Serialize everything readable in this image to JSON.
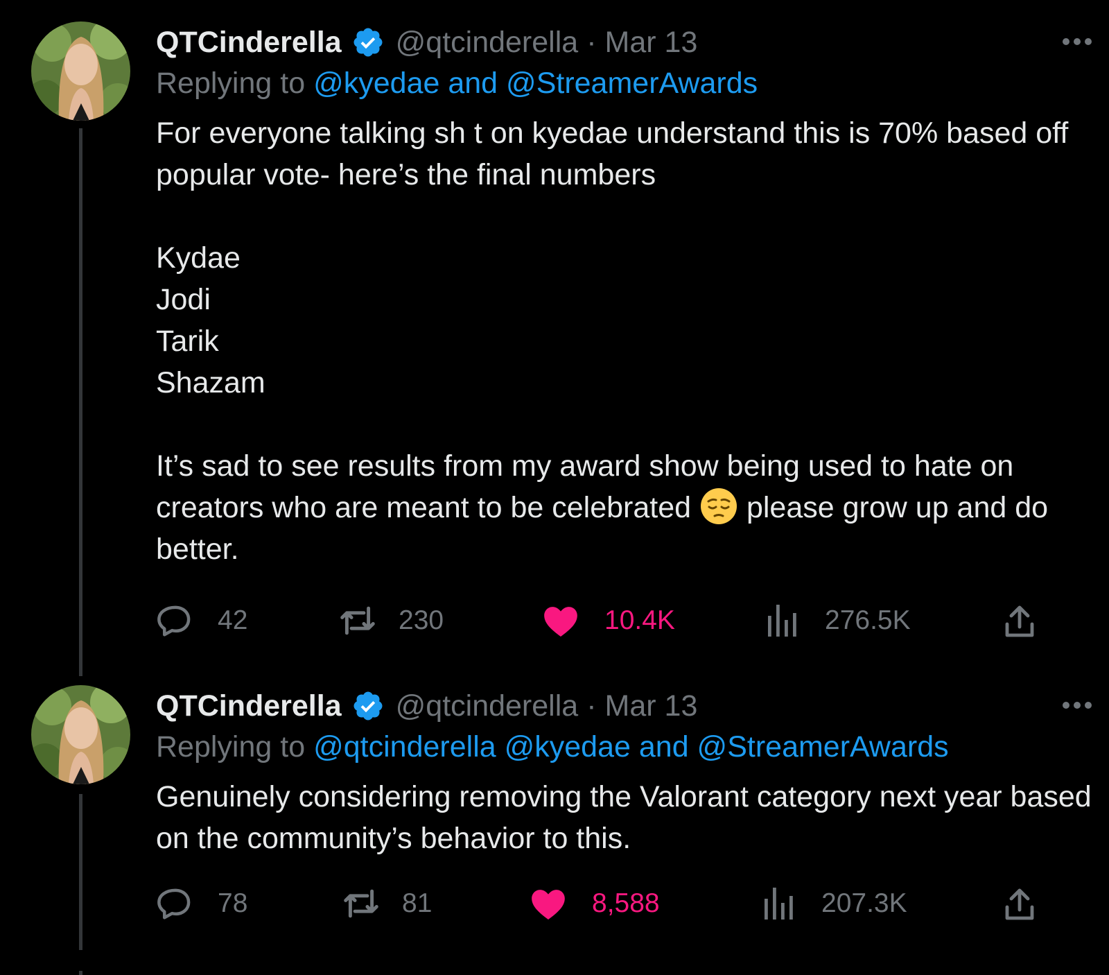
{
  "colors": {
    "background": "#000000",
    "text": "#e7e9ea",
    "muted": "#71767b",
    "link": "#1d9bf0",
    "like": "#f91880",
    "verified": "#1d9bf0",
    "thread_line": "#333639"
  },
  "tweets": [
    {
      "author": {
        "display_name": "QTCinderella",
        "handle": "@qtcinderella",
        "verified": true,
        "avatar_icon": "avatar-photo"
      },
      "separator": "·",
      "date": "Mar 13",
      "more_icon": "more-horizontal-icon",
      "replying_prefix": "Replying to",
      "replying_to": "@kyedae and @StreamerAwards",
      "body": {
        "line1": "For everyone talking sh t on kyedae understand this is 70% based off popular vote- here’s the final numbers",
        "list": [
          "Kydae",
          "Jodi",
          "Tarik",
          "Shazam"
        ],
        "closing_before_emoji": "It’s sad to see results from my award show being used to hate on creators who are meant to be celebrated",
        "emoji": "pensive-face-emoji",
        "closing_after_emoji": "please grow up and do better."
      },
      "stats": {
        "replies": "42",
        "retweets": "230",
        "likes": "10.4K",
        "views": "276.5K"
      },
      "liked": true
    },
    {
      "author": {
        "display_name": "QTCinderella",
        "handle": "@qtcinderella",
        "verified": true,
        "avatar_icon": "avatar-photo"
      },
      "separator": "·",
      "date": "Mar 13",
      "more_icon": "more-horizontal-icon",
      "replying_prefix": "Replying to",
      "replying_to": "@qtcinderella @kyedae and @StreamerAwards",
      "body": {
        "text": "Genuinely considering removing the Valorant category next year based on the community’s behavior to this."
      },
      "stats": {
        "replies": "78",
        "retweets": "81",
        "likes": "8,588",
        "views": "207.3K"
      },
      "liked": true
    }
  ]
}
